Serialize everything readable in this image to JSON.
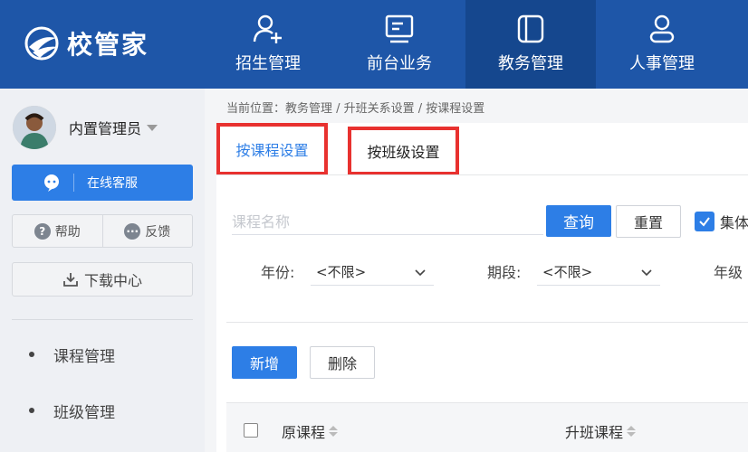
{
  "app": {
    "logo_text": "校管家"
  },
  "topnav": {
    "items": [
      {
        "label": "招生管理",
        "icon": "user-add-icon"
      },
      {
        "label": "前台业务",
        "icon": "monitor-icon"
      },
      {
        "label": "教务管理",
        "icon": "book-icon",
        "active": true
      },
      {
        "label": "人事管理",
        "icon": "person-icon"
      }
    ]
  },
  "sidebar": {
    "user_name": "内置管理员",
    "service_label": "在线客服",
    "help_label": "帮助",
    "feedback_label": "反馈",
    "download_label": "下载中心",
    "menu": [
      {
        "label": "课程管理"
      },
      {
        "label": "班级管理"
      }
    ]
  },
  "breadcrumb": "当前位置：教务管理 / 升班关系设置 / 按课程设置",
  "tabs": {
    "by_course": "按课程设置",
    "by_class": "按班级设置"
  },
  "filters": {
    "search_placeholder": "课程名称",
    "query_label": "查询",
    "reset_label": "重置",
    "checkbox_label": "集体",
    "year_label": "年份:",
    "year_value": "<不限>",
    "period_label": "期段:",
    "period_value": "<不限>",
    "grade_label": "年级"
  },
  "actions": {
    "add_label": "新增",
    "delete_label": "删除"
  },
  "table": {
    "columns": [
      "原课程",
      "升班课程"
    ]
  },
  "colors": {
    "primary": "#2d7ee6",
    "topbar": "#1e56a8",
    "highlight": "#e8312f"
  }
}
